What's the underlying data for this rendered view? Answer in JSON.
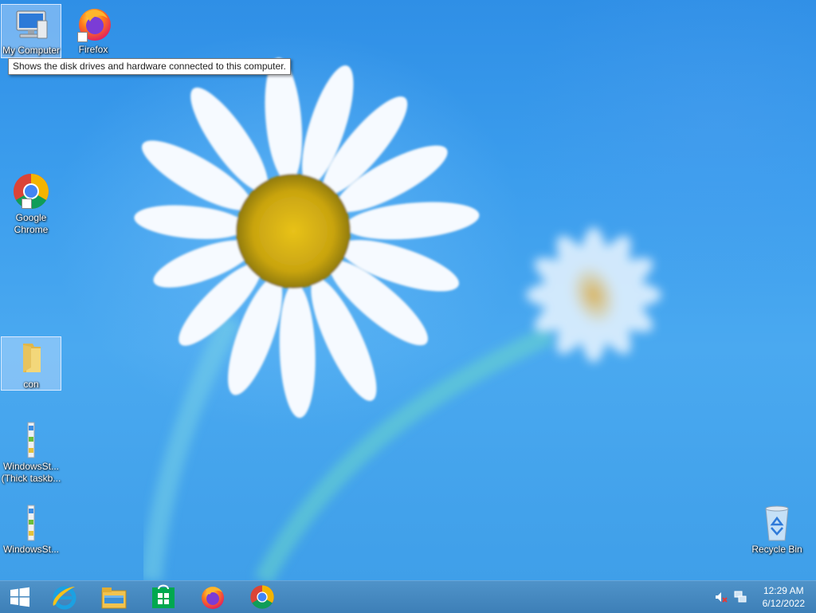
{
  "desktop": {
    "icons": [
      {
        "label": "My Computer",
        "icon": "computer-icon",
        "selected": true
      },
      {
        "label": "Firefox",
        "icon": "firefox-icon",
        "shortcut": true
      },
      {
        "label": "Google Chrome",
        "icon": "chrome-icon",
        "shortcut": true
      },
      {
        "label": "con",
        "icon": "folder-icon",
        "selected": true
      },
      {
        "label": "WindowsSt... (Thick taskb...",
        "icon": "windowsstyle-icon"
      },
      {
        "label": "WindowsSt...",
        "icon": "windowsstyle-icon"
      },
      {
        "label": "Recycle Bin",
        "icon": "recycle-bin-icon"
      }
    ],
    "tooltip": "Shows the disk drives and hardware connected to this computer."
  },
  "taskbar": {
    "buttons": [
      {
        "name": "start",
        "icon": "windows-logo-icon"
      },
      {
        "name": "internet-explorer",
        "icon": "internet-explorer-icon"
      },
      {
        "name": "file-explorer",
        "icon": "file-explorer-icon"
      },
      {
        "name": "store",
        "icon": "store-icon"
      },
      {
        "name": "firefox",
        "icon": "firefox-icon"
      },
      {
        "name": "chrome",
        "icon": "chrome-icon"
      }
    ],
    "tray": {
      "icons": [
        "volume-muted-icon",
        "network-icon"
      ],
      "time": "12:29 AM",
      "date": "6/12/2022"
    }
  },
  "colors": {
    "accent": "#3d7fb7",
    "wallpaper_blue": "#3b9ded"
  }
}
